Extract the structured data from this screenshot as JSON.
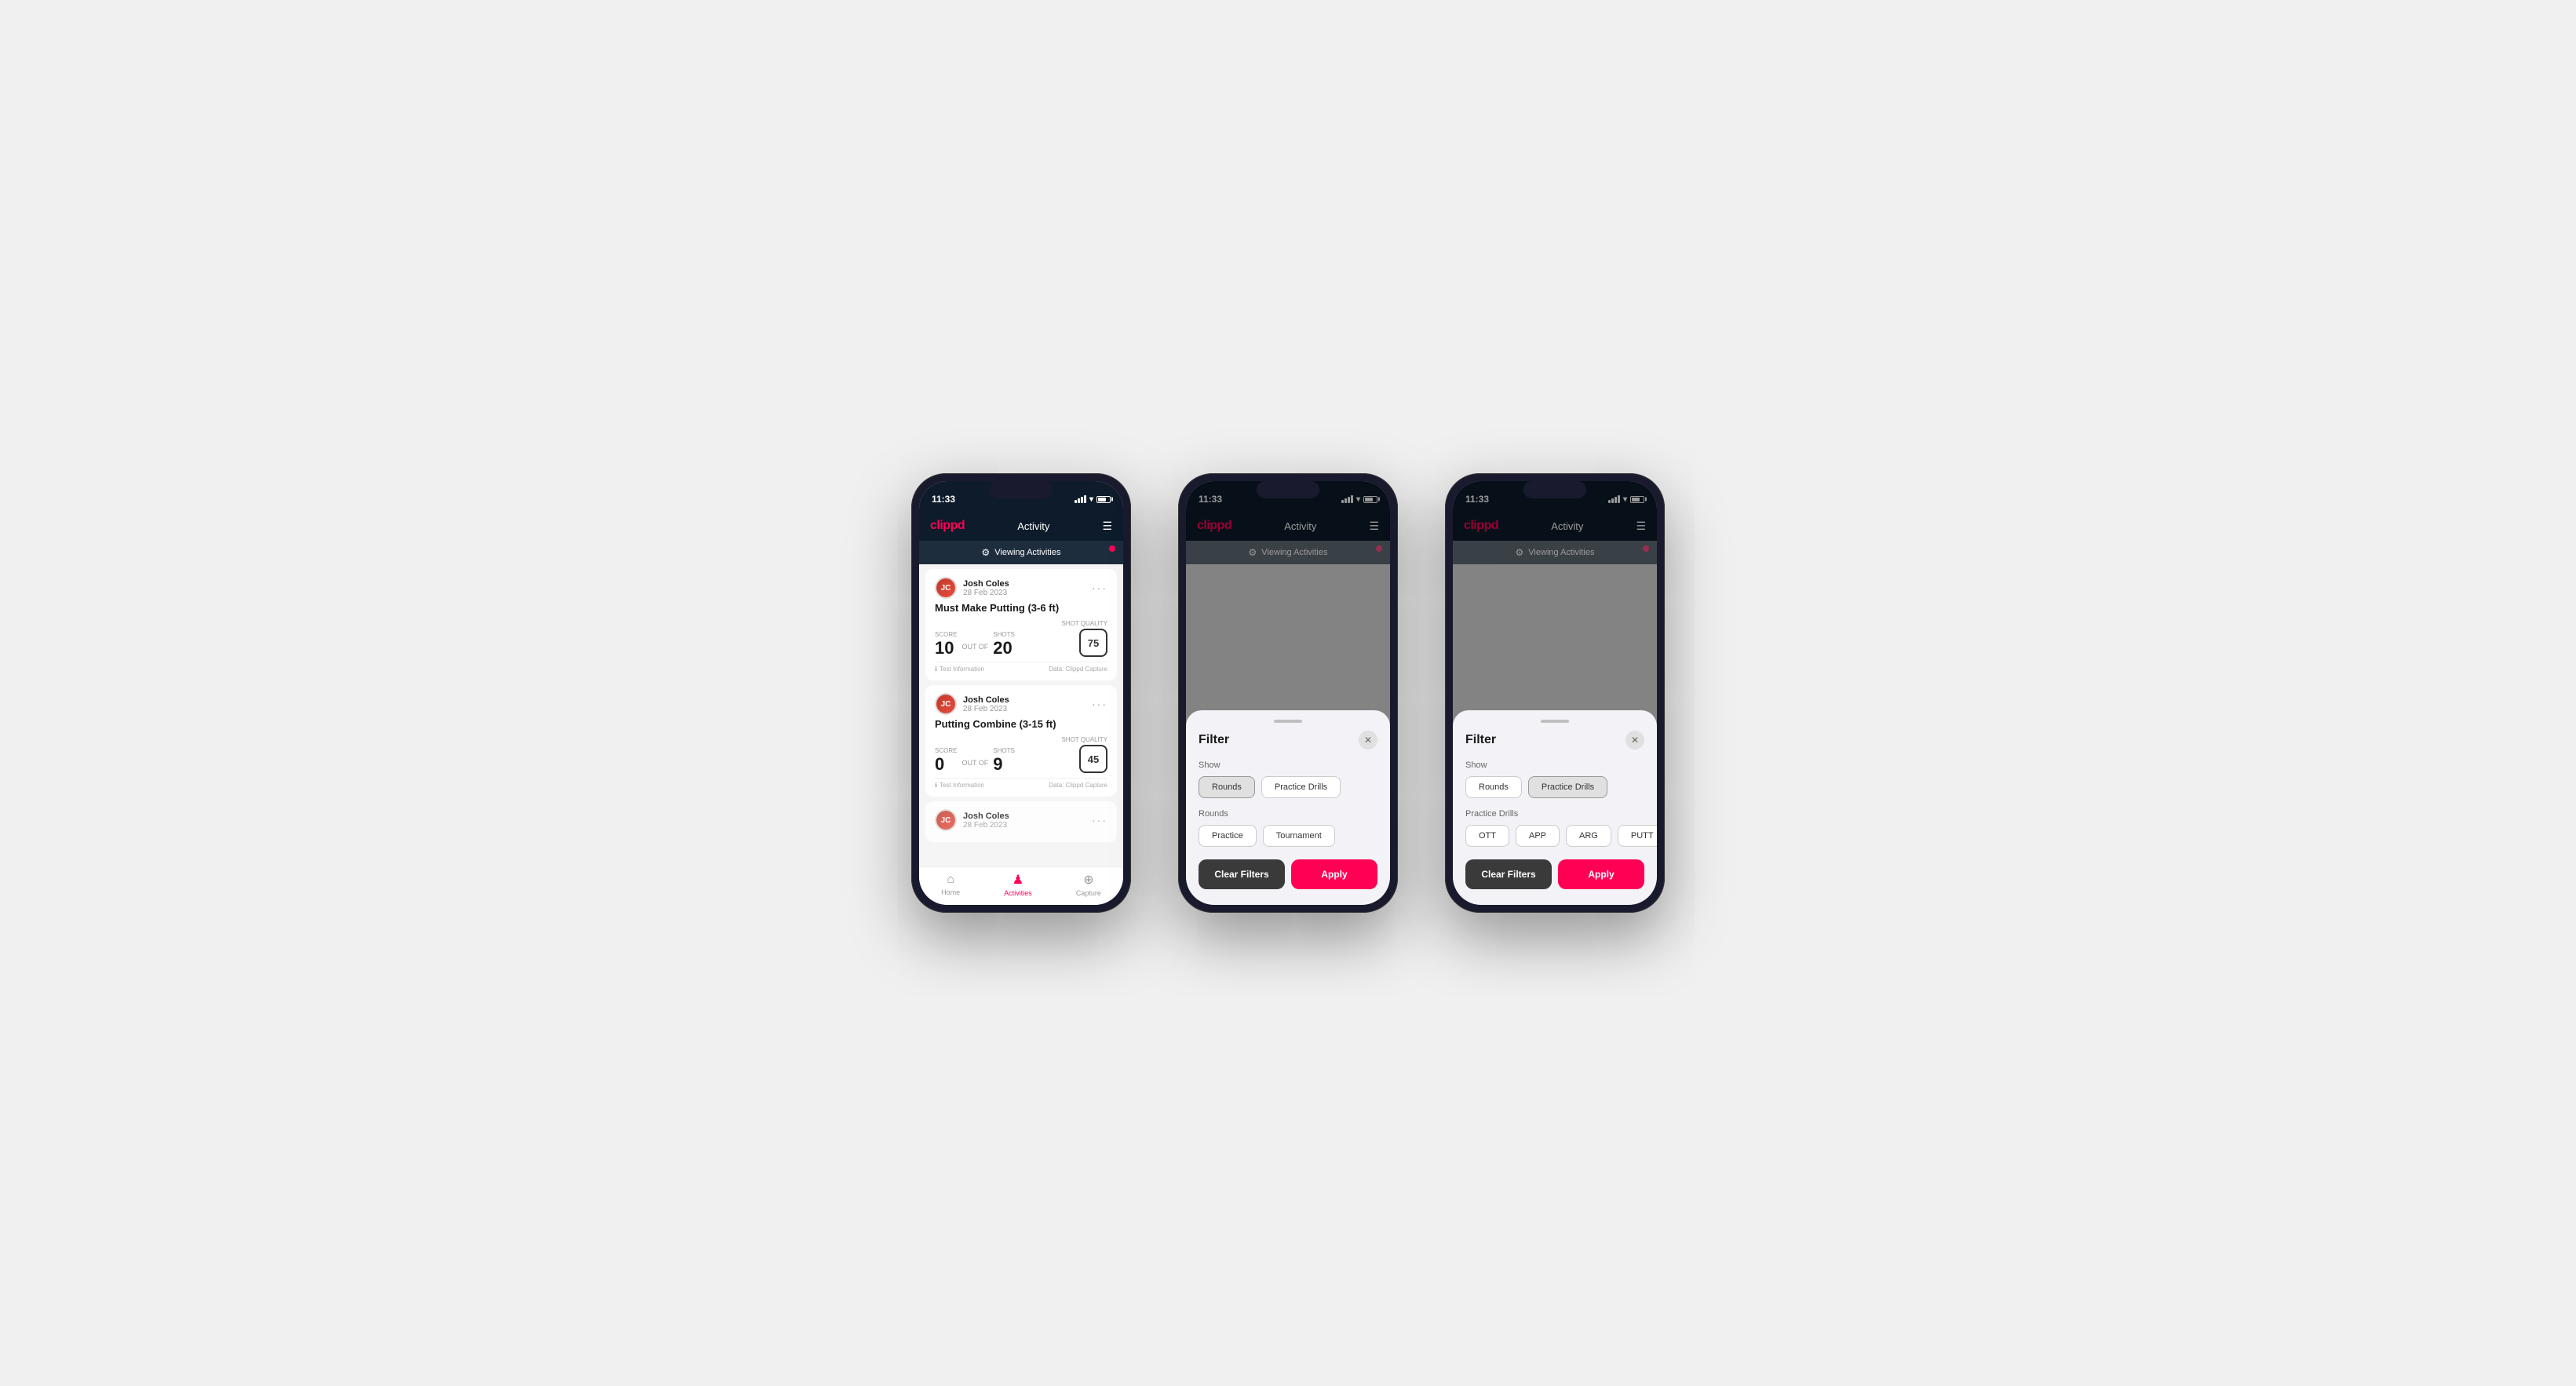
{
  "app": {
    "logo": "clippd",
    "header_title": "Activity",
    "menu_icon": "☰",
    "status_time": "11:33",
    "viewing_label": "Viewing Activities"
  },
  "phone1": {
    "activities": [
      {
        "user_name": "Josh Coles",
        "date": "28 Feb 2023",
        "title": "Must Make Putting (3-6 ft)",
        "score_label": "Score",
        "score_value": "10",
        "out_of": "OUT OF",
        "shots_label": "Shots",
        "shots_value": "20",
        "quality_label": "Shot Quality",
        "quality_value": "75",
        "footer_info": "Test Information",
        "footer_data": "Data: Clippd Capture"
      },
      {
        "user_name": "Josh Coles",
        "date": "28 Feb 2023",
        "title": "Putting Combine (3-15 ft)",
        "score_label": "Score",
        "score_value": "0",
        "out_of": "OUT OF",
        "shots_label": "Shots",
        "shots_value": "9",
        "quality_label": "Shot Quality",
        "quality_value": "45",
        "footer_info": "Test Information",
        "footer_data": "Data: Clippd Capture"
      }
    ],
    "bottom_nav": [
      {
        "label": "Home",
        "icon": "⌂",
        "active": false
      },
      {
        "label": "Activities",
        "icon": "♟",
        "active": true
      },
      {
        "label": "Capture",
        "icon": "⊕",
        "active": false
      }
    ]
  },
  "phone2": {
    "filter": {
      "title": "Filter",
      "show_label": "Show",
      "show_buttons": [
        {
          "label": "Rounds",
          "active": true
        },
        {
          "label": "Practice Drills",
          "active": false
        }
      ],
      "rounds_label": "Rounds",
      "rounds_buttons": [
        {
          "label": "Practice",
          "active": false
        },
        {
          "label": "Tournament",
          "active": false
        }
      ],
      "clear_label": "Clear Filters",
      "apply_label": "Apply"
    }
  },
  "phone3": {
    "filter": {
      "title": "Filter",
      "show_label": "Show",
      "show_buttons": [
        {
          "label": "Rounds",
          "active": false
        },
        {
          "label": "Practice Drills",
          "active": true
        }
      ],
      "drills_label": "Practice Drills",
      "drills_buttons": [
        {
          "label": "OTT",
          "active": false
        },
        {
          "label": "APP",
          "active": false
        },
        {
          "label": "ARG",
          "active": false
        },
        {
          "label": "PUTT",
          "active": false
        }
      ],
      "clear_label": "Clear Filters",
      "apply_label": "Apply"
    }
  }
}
